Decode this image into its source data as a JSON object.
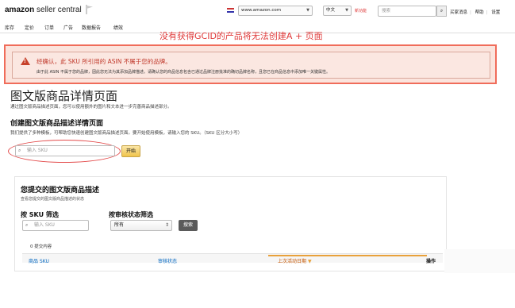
{
  "header": {
    "logo_main": "amazon",
    "logo_sub": " seller central",
    "marketplace": "www.amazon.com",
    "language": "中文",
    "new_badge": "新功能",
    "search_placeholder": "搜索",
    "links": [
      "买家消息",
      "帮助",
      "设置"
    ]
  },
  "nav": {
    "items": [
      "库存",
      "定价",
      "订单",
      "广告",
      "数据报告",
      "绩效"
    ]
  },
  "annotation": {
    "text": "没有获得GCID的产品将无法创建A + 页面"
  },
  "alert": {
    "title": "经确认，此 SKU 所引用的 ASIN 不属于您的品牌。",
    "body": "由于此 ASIN 不属于您的品牌，因此您无法为其添加品牌描述。请确认您的商品信息包含已通过品牌注册批准的确切品牌名称，且您已在商品信息中添加唯一关键属性。"
  },
  "page": {
    "title": "图文版商品详情页面",
    "subtitle": "通过图文版商品描述页面，您可以使用额外的图片和文本进一步完善商品描述部分。"
  },
  "create": {
    "title": "创建图文版商品描述详情页面",
    "subtitle": "我们提供了多种模板，可帮助您快速创建图文版商品描述页面。要开始使用模板，请输入您的 SKU。（SKU 区分大小写）",
    "sku_placeholder": "输入 SKU",
    "start_label": "开始"
  },
  "submitted": {
    "title": "您提交的图文版商品描述",
    "subtitle": "查看您提交的图文版商品描述的状态",
    "filter_sku_label": "按 SKU 筛选",
    "filter_status_label": "按审核状态筛选",
    "filter_sku_placeholder": "输入 SKU",
    "status_value": "所有",
    "search_label": "搜索",
    "count_text": "0 提交内容",
    "columns": [
      "商品 SKU",
      "审核状态",
      "上次活动日期",
      "操作"
    ]
  }
}
